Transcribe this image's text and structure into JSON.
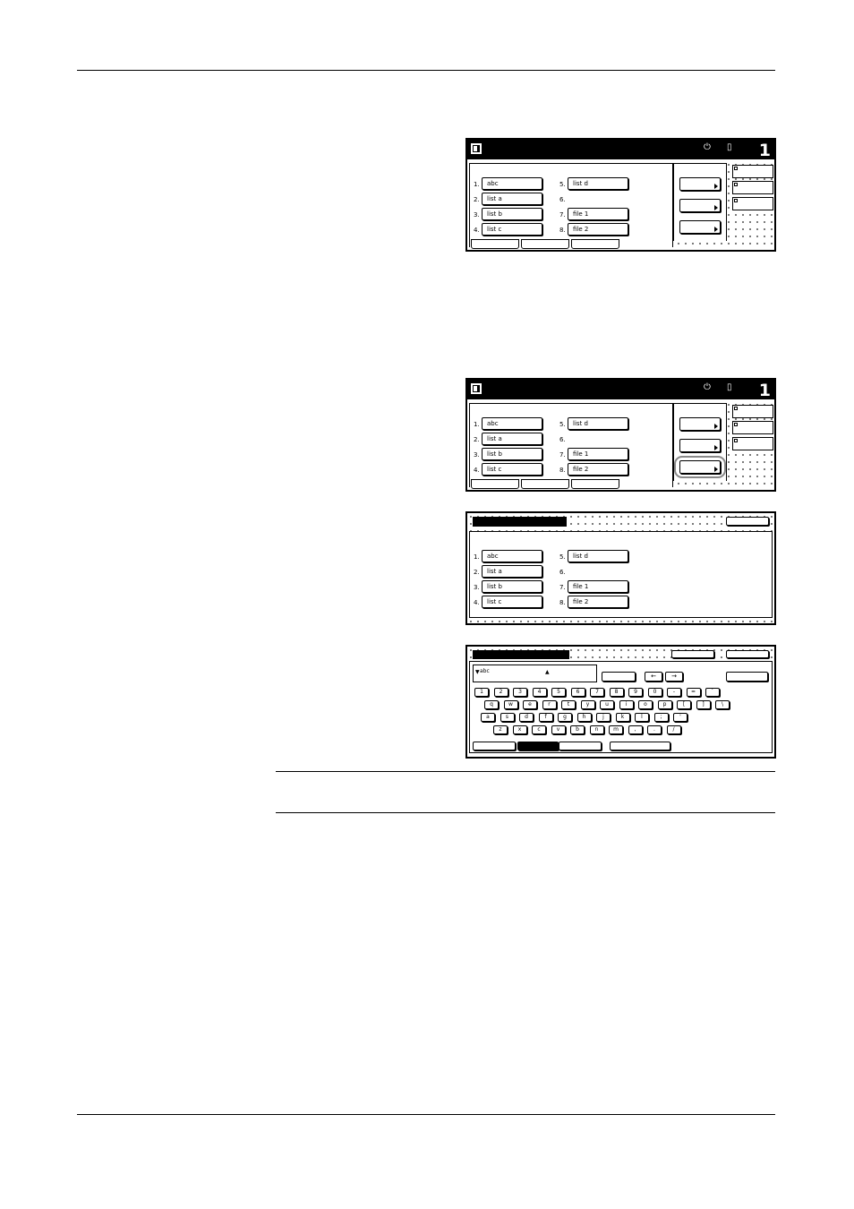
{
  "panel": {
    "title_count": "1",
    "slots_left": [
      {
        "num": "1.",
        "label": "abc"
      },
      {
        "num": "2.",
        "label": "list a"
      },
      {
        "num": "3.",
        "label": "list b"
      },
      {
        "num": "4.",
        "label": "list c"
      }
    ],
    "slots_right": [
      {
        "num": "5.",
        "label": "list d"
      },
      {
        "num": "6.",
        "label": ""
      },
      {
        "num": "7.",
        "label": "file 1"
      },
      {
        "num": "8.",
        "label": "file 2"
      }
    ]
  },
  "keyboard": {
    "input_value": "abc",
    "arrow_left": "←",
    "arrow_right": "→",
    "row1": [
      "1",
      "2",
      "3",
      "4",
      "5",
      "6",
      "7",
      "8",
      "9",
      "0",
      "-",
      "=",
      "`"
    ],
    "row2": [
      "q",
      "w",
      "e",
      "r",
      "t",
      "y",
      "u",
      "i",
      "o",
      "p",
      "[",
      "]",
      "\\"
    ],
    "row3": [
      "a",
      "s",
      "d",
      "f",
      "g",
      "h",
      "j",
      "k",
      "l",
      ";",
      "'"
    ],
    "row4": [
      "z",
      "x",
      "c",
      "v",
      "b",
      "n",
      "m",
      ",",
      ".",
      "/"
    ]
  }
}
